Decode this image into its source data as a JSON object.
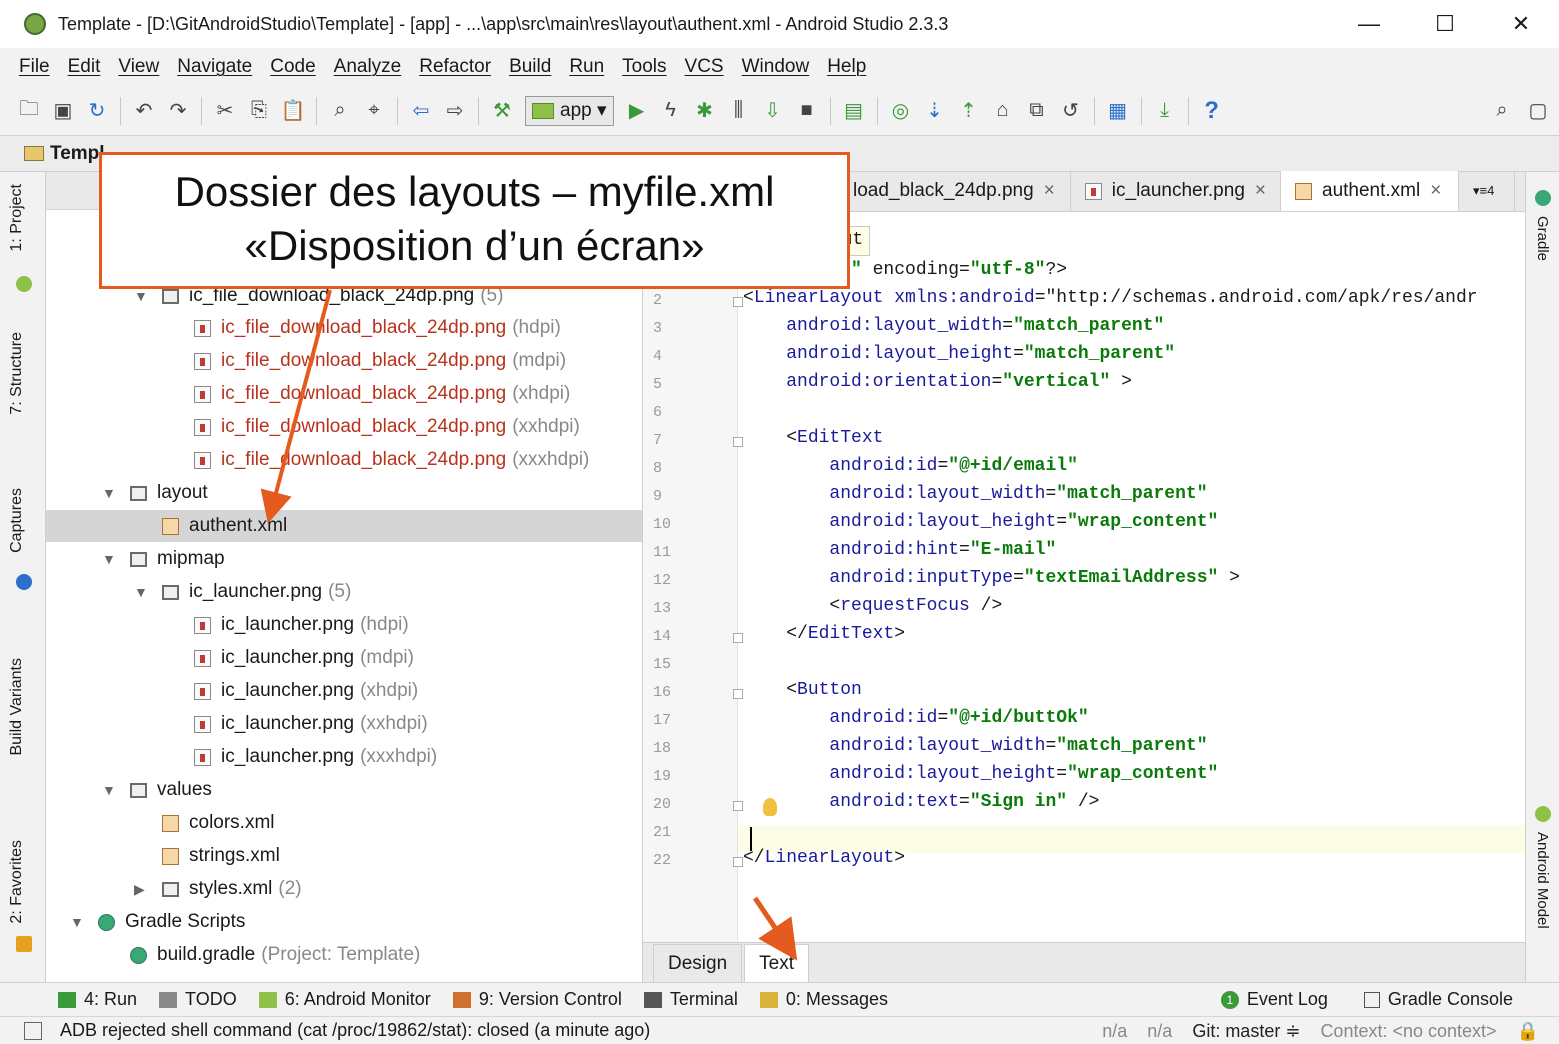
{
  "window": {
    "title": "Template - [D:\\GitAndroidStudio\\Template] - [app] - ...\\app\\src\\main\\res\\layout\\authent.xml - Android Studio 2.3.3",
    "minimize": "—",
    "maximize": "☐",
    "close": "✕"
  },
  "menu": [
    "File",
    "Edit",
    "View",
    "Navigate",
    "Code",
    "Analyze",
    "Refactor",
    "Build",
    "Run",
    "Tools",
    "VCS",
    "Window",
    "Help"
  ],
  "toolbar": {
    "run_config": "app"
  },
  "navbar": {
    "root": "Templ"
  },
  "left_tabs": {
    "project": "1: Project",
    "structure": "7: Structure",
    "captures": "Captures",
    "build_variants": "Build Variants",
    "favorites": "2: Favorites"
  },
  "right_tabs": {
    "gradle": "Gradle",
    "android_model": "Android Model"
  },
  "tree": [
    {
      "label": "ic_file_download_black_24dp.png",
      "suffix": "(5)",
      "color": "normal",
      "indent": 2,
      "icon": "folder",
      "expanded": true
    },
    {
      "label": "ic_file_download_black_24dp.png",
      "suffix": "(hdpi)",
      "color": "red",
      "indent": 3,
      "icon": "img"
    },
    {
      "label": "ic_file_download_black_24dp.png",
      "suffix": "(mdpi)",
      "color": "red",
      "indent": 3,
      "icon": "img"
    },
    {
      "label": "ic_file_download_black_24dp.png",
      "suffix": "(xhdpi)",
      "color": "red",
      "indent": 3,
      "icon": "img"
    },
    {
      "label": "ic_file_download_black_24dp.png",
      "suffix": "(xxhdpi)",
      "color": "red",
      "indent": 3,
      "icon": "img"
    },
    {
      "label": "ic_file_download_black_24dp.png",
      "suffix": "(xxxhdpi)",
      "color": "red",
      "indent": 3,
      "icon": "img"
    },
    {
      "label": "layout",
      "suffix": "",
      "color": "normal",
      "indent": 1,
      "icon": "folder",
      "expanded": true
    },
    {
      "label": "authent.xml",
      "suffix": "",
      "color": "normal",
      "indent": 2,
      "icon": "xml",
      "selected": true
    },
    {
      "label": "mipmap",
      "suffix": "",
      "color": "normal",
      "indent": 1,
      "icon": "folder",
      "expanded": true
    },
    {
      "label": "ic_launcher.png",
      "suffix": "(5)",
      "color": "normal",
      "indent": 2,
      "icon": "folder",
      "expanded": true
    },
    {
      "label": "ic_launcher.png",
      "suffix": "(hdpi)",
      "color": "normal",
      "indent": 3,
      "icon": "img"
    },
    {
      "label": "ic_launcher.png",
      "suffix": "(mdpi)",
      "color": "normal",
      "indent": 3,
      "icon": "img"
    },
    {
      "label": "ic_launcher.png",
      "suffix": "(xhdpi)",
      "color": "normal",
      "indent": 3,
      "icon": "img"
    },
    {
      "label": "ic_launcher.png",
      "suffix": "(xxhdpi)",
      "color": "normal",
      "indent": 3,
      "icon": "img"
    },
    {
      "label": "ic_launcher.png",
      "suffix": "(xxxhdpi)",
      "color": "normal",
      "indent": 3,
      "icon": "img"
    },
    {
      "label": "values",
      "suffix": "",
      "color": "normal",
      "indent": 1,
      "icon": "folder",
      "expanded": true
    },
    {
      "label": "colors.xml",
      "suffix": "",
      "color": "normal",
      "indent": 2,
      "icon": "xml"
    },
    {
      "label": "strings.xml",
      "suffix": "",
      "color": "normal",
      "indent": 2,
      "icon": "xml"
    },
    {
      "label": "styles.xml",
      "suffix": "(2)",
      "color": "normal",
      "indent": 2,
      "icon": "folder",
      "expanded": false
    },
    {
      "label": "Gradle Scripts",
      "suffix": "",
      "color": "normal",
      "indent": 0,
      "icon": "gradle",
      "expanded": true
    },
    {
      "label": "build.gradle",
      "suffix": "(Project: Template)",
      "color": "normal",
      "indent": 1,
      "icon": "gradle"
    }
  ],
  "editor_tabs": [
    {
      "label": "load_black_24dp.png",
      "active": false
    },
    {
      "label": "ic_launcher.png",
      "active": false
    },
    {
      "label": "authent.xml",
      "active": true
    },
    {
      "label": "▾≡4",
      "active": false,
      "overflow": true
    }
  ],
  "breadcrumb_tag": "yout",
  "code_lines": [
    {
      "n": "",
      "text": "rsion=\"1.0\" encoding=\"utf-8\"?>"
    },
    {
      "n": "2",
      "text": "<LinearLayout xmlns:android=\"http://schemas.android.com/apk/res/andr"
    },
    {
      "n": "3",
      "text": "    android:layout_width=\"match_parent\""
    },
    {
      "n": "4",
      "text": "    android:layout_height=\"match_parent\""
    },
    {
      "n": "5",
      "text": "    android:orientation=\"vertical\" >"
    },
    {
      "n": "6",
      "text": ""
    },
    {
      "n": "7",
      "text": "    <EditText"
    },
    {
      "n": "8",
      "text": "        android:id=\"@+id/email\""
    },
    {
      "n": "9",
      "text": "        android:layout_width=\"match_parent\""
    },
    {
      "n": "10",
      "text": "        android:layout_height=\"wrap_content\""
    },
    {
      "n": "11",
      "text": "        android:hint=\"E-mail\""
    },
    {
      "n": "12",
      "text": "        android:inputType=\"textEmailAddress\" >"
    },
    {
      "n": "13",
      "text": "        <requestFocus />"
    },
    {
      "n": "14",
      "text": "    </EditText>"
    },
    {
      "n": "15",
      "text": ""
    },
    {
      "n": "16",
      "text": "    <Button"
    },
    {
      "n": "17",
      "text": "        android:id=\"@+id/buttOk\""
    },
    {
      "n": "18",
      "text": "        android:layout_width=\"match_parent\""
    },
    {
      "n": "19",
      "text": "        android:layout_height=\"wrap_content\""
    },
    {
      "n": "20",
      "text": "        android:text=\"Sign in\" />"
    },
    {
      "n": "21",
      "text": ""
    },
    {
      "n": "22",
      "text": "</LinearLayout>"
    }
  ],
  "design_tabs": {
    "design": "Design",
    "text": "Text"
  },
  "tool_windows": [
    {
      "label": "4: Run",
      "icon": "run-icon"
    },
    {
      "label": "TODO",
      "icon": "todo-icon"
    },
    {
      "label": "6: Android Monitor",
      "icon": "android-icon"
    },
    {
      "label": "9: Version Control",
      "icon": "vcs-icon"
    },
    {
      "label": "Terminal",
      "icon": "terminal-icon"
    },
    {
      "label": "0: Messages",
      "icon": "messages-icon"
    }
  ],
  "tool_windows_right": [
    {
      "label": "Event Log",
      "badge": "1"
    },
    {
      "label": "Gradle Console"
    }
  ],
  "status": {
    "message": "ADB rejected shell command (cat /proc/19862/stat): closed (a minute ago)",
    "na1": "n/a",
    "na2": "n/a",
    "git": "Git: master ≑",
    "context": "Context: <no context>"
  },
  "callout": {
    "line1": "Dossier des layouts – myfile.xml",
    "line2": "«Disposition d’un écran»"
  },
  "colors": {
    "callout_border": "#e55b1f",
    "arrow": "#e55b1f",
    "accent_green": "#3a9a3a"
  }
}
